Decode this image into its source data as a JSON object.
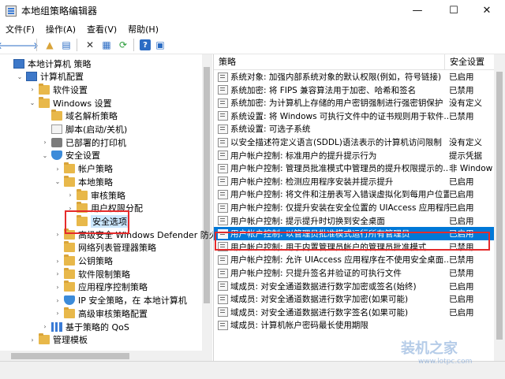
{
  "window": {
    "title": "本地组策略编辑器",
    "min_glyph": "—",
    "max_glyph": "☐",
    "close_glyph": "✕"
  },
  "menu": [
    "文件(F)",
    "操作(A)",
    "查看(V)",
    "帮助(H)"
  ],
  "toolbar": {
    "back": "🡐",
    "forward": "🡒",
    "up": "▲",
    "show_tree": "▤",
    "delete": "✕",
    "properties": "▦",
    "refresh": "⟳",
    "help": "?",
    "view": "▣"
  },
  "tree": [
    {
      "label": "本地计算机 策略",
      "expander": "",
      "icon": "computer-icon",
      "level": 0
    },
    {
      "label": "计算机配置",
      "expander": "⌄",
      "icon": "computer-icon",
      "level": 1
    },
    {
      "label": "软件设置",
      "expander": "›",
      "icon": "folder-icon",
      "level": 2
    },
    {
      "label": "Windows 设置",
      "expander": "⌄",
      "icon": "folder-icon",
      "level": 2
    },
    {
      "label": "域名解析策略",
      "expander": "",
      "icon": "folder-icon",
      "level": 3
    },
    {
      "label": "脚本(启动/关机)",
      "expander": "",
      "icon": "script-icon",
      "level": 3
    },
    {
      "label": "已部署的打印机",
      "expander": "›",
      "icon": "printer-icon",
      "level": 3
    },
    {
      "label": "安全设置",
      "expander": "⌄",
      "icon": "shield-icon",
      "level": 3
    },
    {
      "label": "帐户策略",
      "expander": "›",
      "icon": "folder-icon",
      "level": 4
    },
    {
      "label": "本地策略",
      "expander": "⌄",
      "icon": "folder-icon",
      "level": 4
    },
    {
      "label": "审核策略",
      "expander": "›",
      "icon": "folder-icon",
      "level": 5
    },
    {
      "label": "用户权限分配",
      "expander": "›",
      "icon": "folder-icon",
      "level": 5
    },
    {
      "label": "安全选项",
      "expander": "",
      "icon": "folder-icon",
      "level": 5,
      "selected": true
    },
    {
      "label": "高级安全 Windows Defender 防火墙",
      "expander": "›",
      "icon": "folder-icon",
      "level": 4
    },
    {
      "label": "网络列表管理器策略",
      "expander": "",
      "icon": "folder-icon",
      "level": 4
    },
    {
      "label": "公钥策略",
      "expander": "›",
      "icon": "folder-icon",
      "level": 4
    },
    {
      "label": "软件限制策略",
      "expander": "›",
      "icon": "folder-icon",
      "level": 4
    },
    {
      "label": "应用程序控制策略",
      "expander": "›",
      "icon": "folder-icon",
      "level": 4
    },
    {
      "label": "IP 安全策略，在 本地计算机",
      "expander": "›",
      "icon": "shield-icon",
      "level": 4
    },
    {
      "label": "高级审核策略配置",
      "expander": "›",
      "icon": "folder-icon",
      "level": 4
    },
    {
      "label": "基于策略的 QoS",
      "expander": "›",
      "icon": "chart-icon",
      "level": 3
    },
    {
      "label": "管理模板",
      "expander": "›",
      "icon": "folder-icon",
      "level": 2
    }
  ],
  "list": {
    "col_policy": "策略",
    "col_setting": "安全设置",
    "rows": [
      {
        "name": "系统对象: 加强内部系统对象的默认权限(例如，符号链接)",
        "value": "已启用"
      },
      {
        "name": "系统加密: 将 FIPS 兼容算法用于加密、哈希和签名",
        "value": "已禁用"
      },
      {
        "name": "系统加密: 为计算机上存储的用户密钥强制进行强密钥保护",
        "value": "没有定义"
      },
      {
        "name": "系统设置: 将 Windows 可执行文件中的证书规则用于软件...",
        "value": "已禁用"
      },
      {
        "name": "系统设置: 可选子系统",
        "value": ""
      },
      {
        "name": "以安全描述符定义语言(SDDL)语法表示的计算机访问限制",
        "value": "没有定义"
      },
      {
        "name": "用户帐户控制: 标准用户的提升提示行为",
        "value": "提示凭据"
      },
      {
        "name": "用户帐户控制: 管理员批准模式中管理员的提升权限提示的...",
        "value": "非 Window"
      },
      {
        "name": "用户帐户控制: 检测应用程序安装并提示提升",
        "value": "已启用"
      },
      {
        "name": "用户帐户控制: 将文件和注册表写入错误虚拟化到每用户位置",
        "value": "已启用"
      },
      {
        "name": "用户帐户控制: 仅提升安装在安全位置的 UIAccess 应用程序",
        "value": "已启用"
      },
      {
        "name": "用户帐户控制: 提示提升时切换到安全桌面",
        "value": "已启用"
      },
      {
        "name": "用户帐户控制: 以管理员批准模式运行所有管理员",
        "value": "已启用",
        "selected": true
      },
      {
        "name": "用户帐户控制: 用于内置管理员帐户的管理员批准模式",
        "value": "已禁用"
      },
      {
        "name": "用户帐户控制: 允许 UIAccess 应用程序在不使用安全桌面...",
        "value": "已禁用"
      },
      {
        "name": "用户帐户控制: 只提升签名并验证的可执行文件",
        "value": "已禁用"
      },
      {
        "name": "域成员: 对安全通道数据进行数字加密或签名(始终)",
        "value": "已启用"
      },
      {
        "name": "域成员: 对安全通道数据进行数字加密(如果可能)",
        "value": "已启用"
      },
      {
        "name": "域成员: 对安全通道数据进行数字签名(如果可能)",
        "value": "已启用"
      },
      {
        "name": "域成员: 计算机帐户密码最长使用期限",
        "value": ""
      }
    ]
  },
  "watermark": {
    "text": "装机之家",
    "url": "www.lotpc.com"
  }
}
